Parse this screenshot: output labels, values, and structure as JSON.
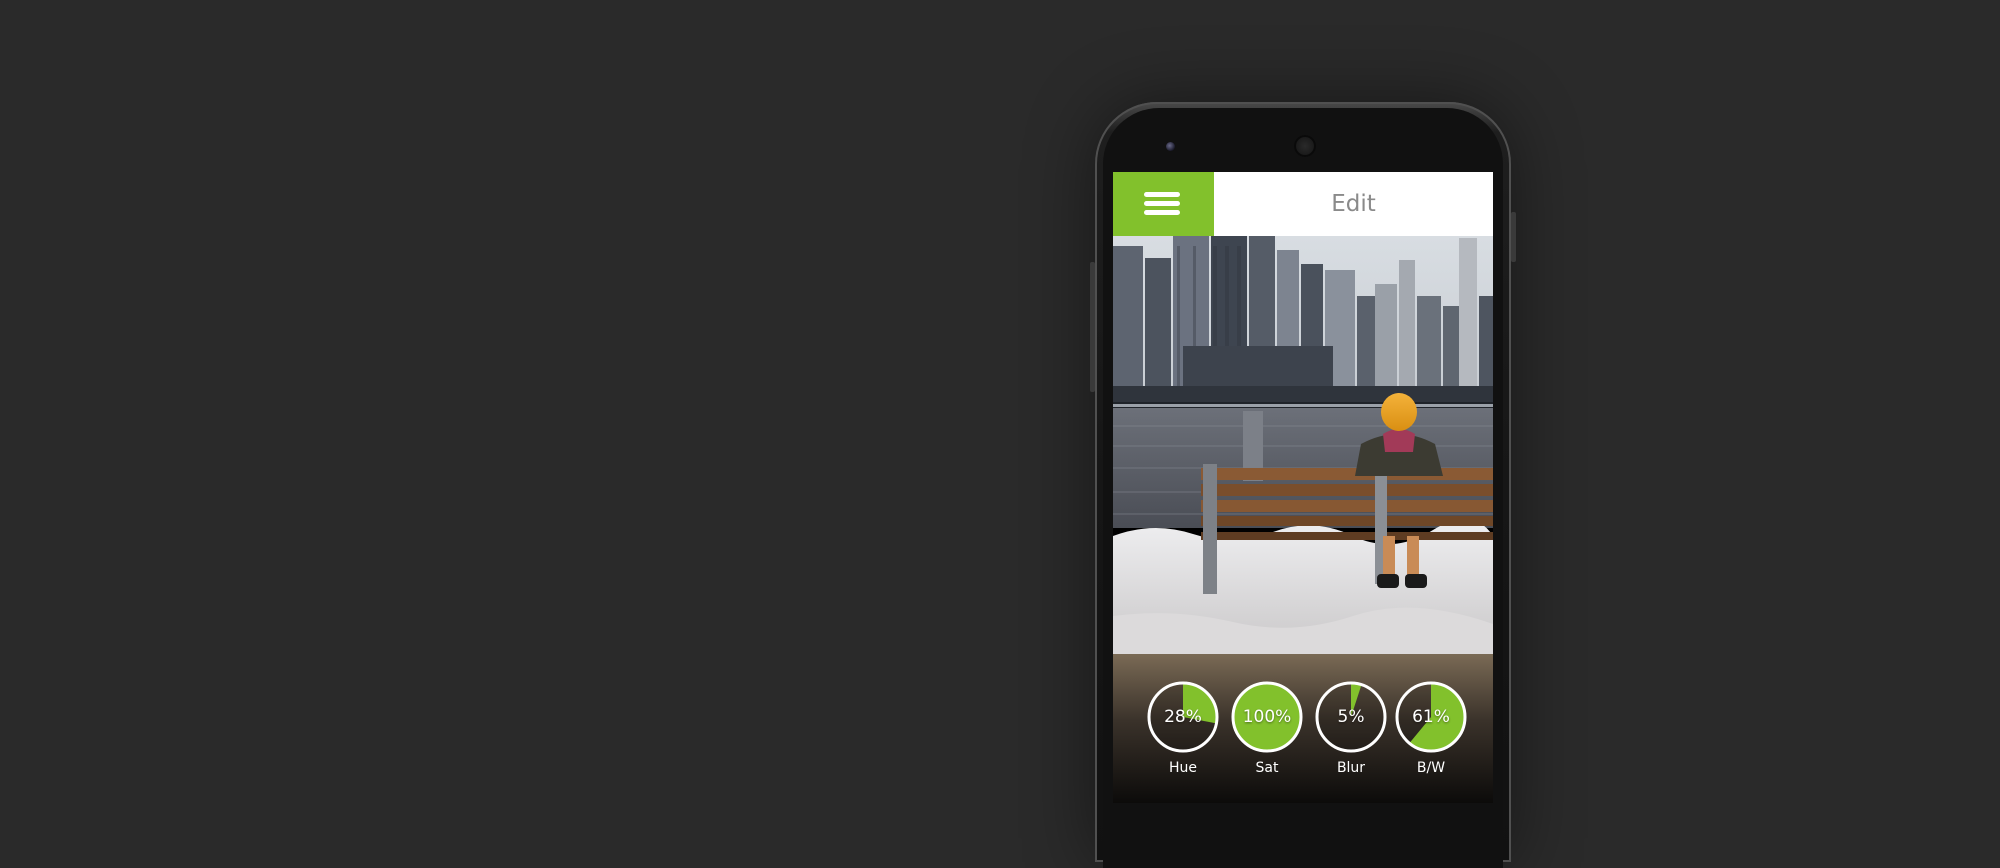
{
  "app_bar": {
    "menu_icon": "hamburger-menu-icon",
    "title": "Edit"
  },
  "colors": {
    "accent": "#82c12c",
    "background": "#2a2a2a",
    "title_text": "#8a8a8a"
  },
  "filters": [
    {
      "label": "Hue",
      "value_text": "28%",
      "value": 0.28
    },
    {
      "label": "Sat",
      "value_text": "100%",
      "value": 1.0
    },
    {
      "label": "Blur",
      "value_text": "5%",
      "value": 0.05
    },
    {
      "label": "B/W",
      "value_text": "61%",
      "value": 0.61
    }
  ]
}
